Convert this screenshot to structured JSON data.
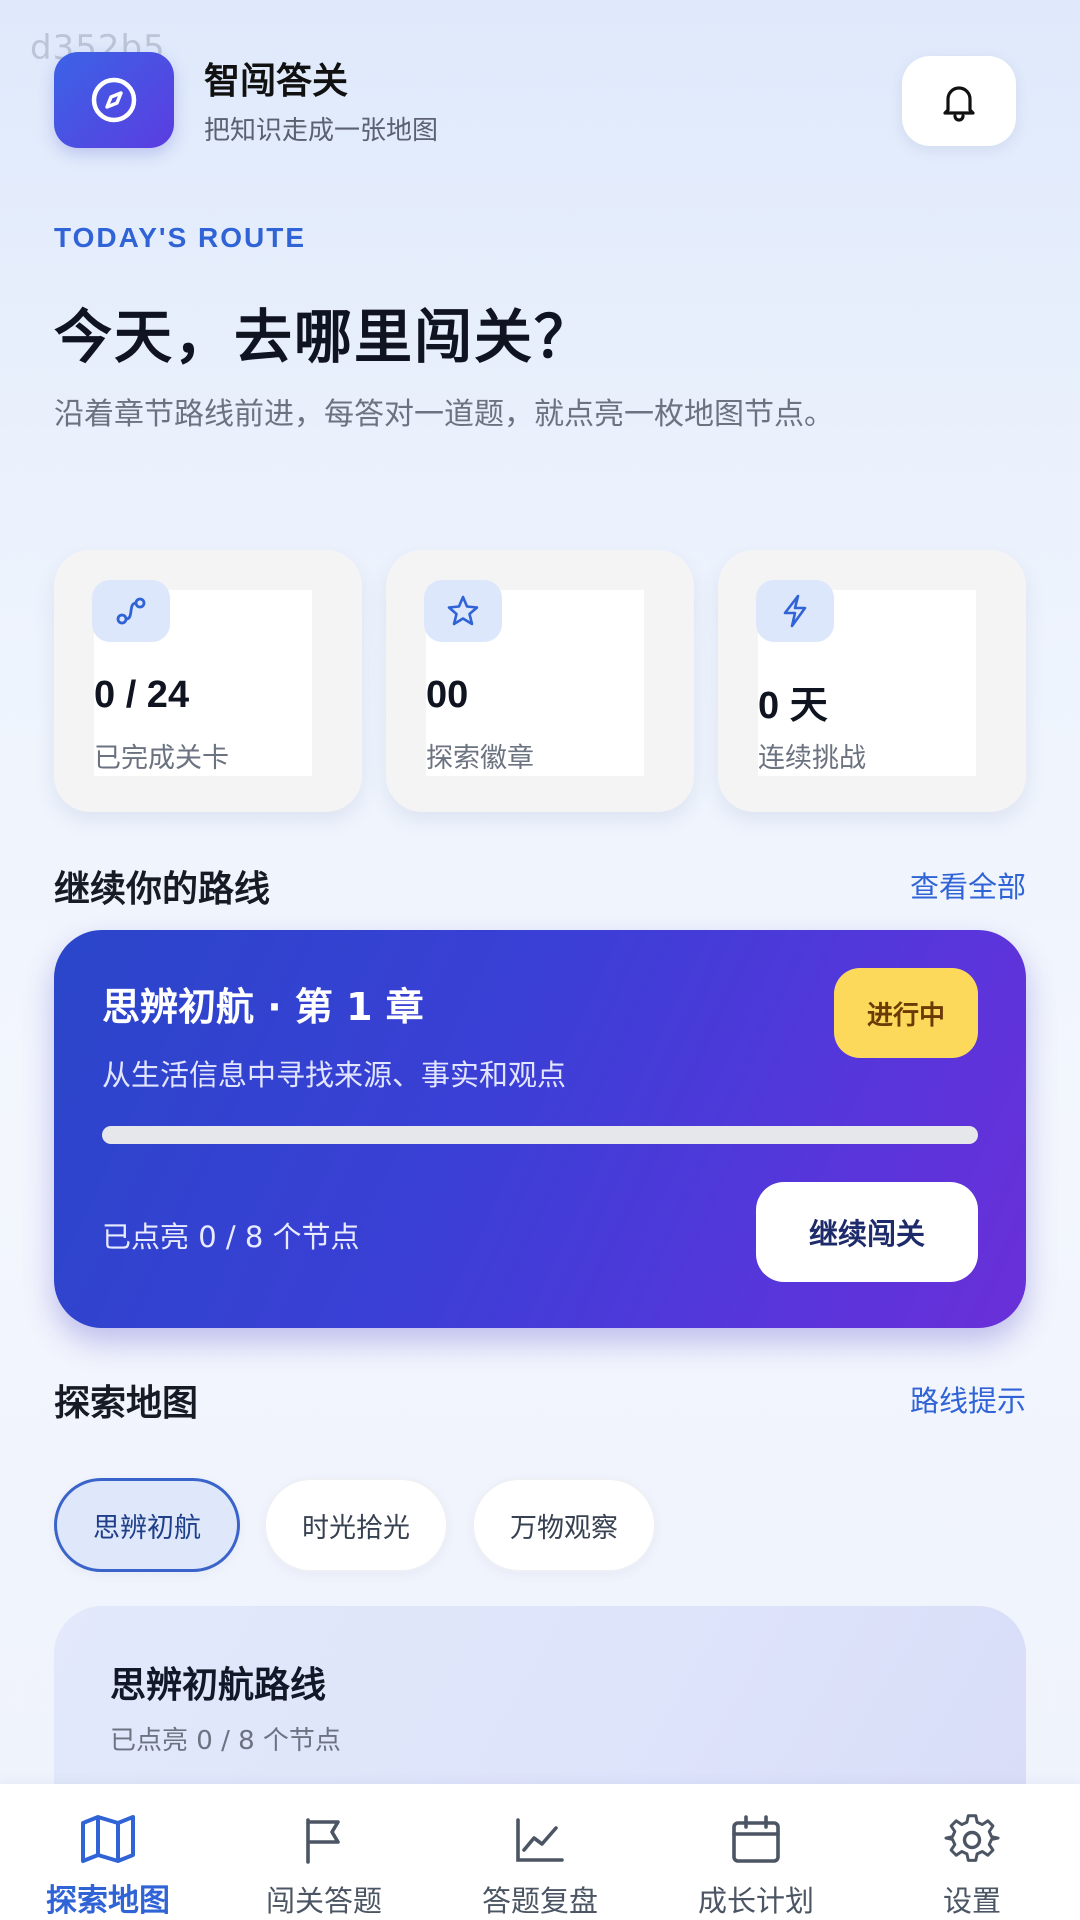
{
  "watermark": "d352b5",
  "app": {
    "title": "智闯答关",
    "subtitle": "把知识走成一张地图",
    "logo_icon": "compass-icon",
    "notification_icon": "bell-icon"
  },
  "hero": {
    "eyebrow": "TODAY'S ROUTE",
    "title": "今天，去哪里闯关？",
    "description": "沿着章节路线前进，每答对一道题，就点亮一枚地图节点。"
  },
  "stats": [
    {
      "icon": "route-icon",
      "value": "0 / 24",
      "label": "已完成关卡"
    },
    {
      "icon": "star-icon",
      "value": "00",
      "label": "探索徽章"
    },
    {
      "icon": "lightning-icon",
      "value": "0 天",
      "label": "连续挑战"
    }
  ],
  "continue_section": {
    "title": "继续你的路线",
    "link": "查看全部"
  },
  "chapter": {
    "title": "思辨初航 · 第 1 章",
    "description": "从生活信息中寻找来源、事实和观点",
    "status": "进行中",
    "progress": 0,
    "nodes_text": "已点亮 0 / 8 个节点",
    "button": "继续闯关"
  },
  "map_section": {
    "title": "探索地图",
    "link": "路线提示"
  },
  "chips": [
    {
      "label": "思辨初航",
      "active": true
    },
    {
      "label": "时光拾光",
      "active": false
    },
    {
      "label": "万物观察",
      "active": false
    }
  ],
  "route_card": {
    "title": "思辨初航路线",
    "subtitle": "已点亮 0 / 8 个节点"
  },
  "nav": [
    {
      "icon": "map-icon",
      "label": "探索地图",
      "active": true
    },
    {
      "icon": "flag-icon",
      "label": "闯关答题",
      "active": false
    },
    {
      "icon": "chart-line-icon",
      "label": "答题复盘",
      "active": false
    },
    {
      "icon": "calendar-icon",
      "label": "成长计划",
      "active": false
    },
    {
      "icon": "gear-icon",
      "label": "设置",
      "active": false
    }
  ],
  "colors": {
    "accent": "#2f63d6",
    "badge": "#fcd95b",
    "card_gradient_start": "#2a46c9",
    "card_gradient_end": "#6a2fd8"
  }
}
